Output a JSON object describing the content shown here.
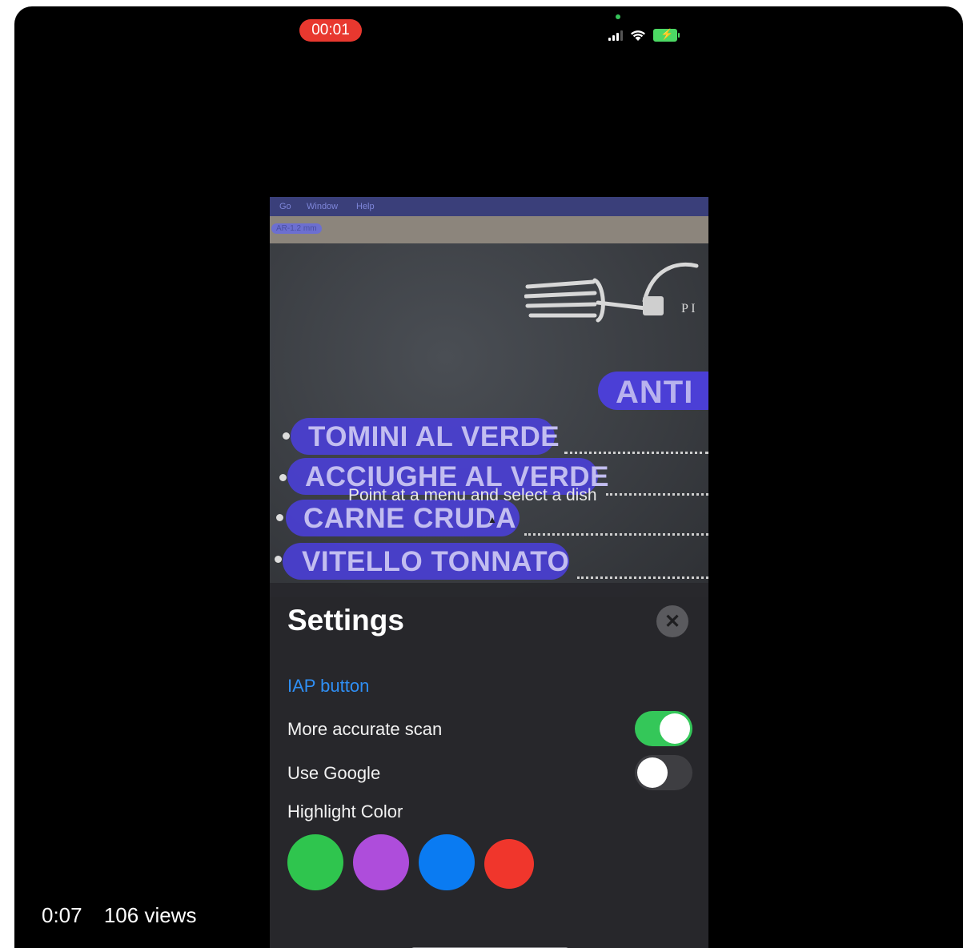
{
  "status_bar": {
    "recording_time": "00:01"
  },
  "camera_view": {
    "menubar_items": [
      "Go",
      "Window",
      "Help"
    ],
    "strip_label": "AR-1.2 mm",
    "section_heading": "ANTI",
    "dishes": [
      "TOMINI AL VERDE",
      "ACCIUGHE AL VERDE",
      "CARNE CRUDA",
      "VITELLO TONNATO"
    ],
    "hint": "Point at a menu and select a dish",
    "highlight_color": "#4a3fd6"
  },
  "settings": {
    "title": "Settings",
    "iap_label": "IAP button",
    "rows": [
      {
        "label": "More accurate scan",
        "enabled": true
      },
      {
        "label": "Use Google",
        "enabled": false
      }
    ],
    "highlight_color_label": "Highlight Color",
    "swatches": [
      {
        "name": "green",
        "color": "#2fc54e"
      },
      {
        "name": "purple",
        "color": "#ae4ddb"
      },
      {
        "name": "blue",
        "color": "#0a7bf2"
      },
      {
        "name": "red",
        "color": "#f0362c"
      }
    ],
    "accent_color": "#2f8ff5",
    "toggle_on_color": "#34c759"
  },
  "video_overlay": {
    "duration": "0:07",
    "views": "106 views"
  }
}
